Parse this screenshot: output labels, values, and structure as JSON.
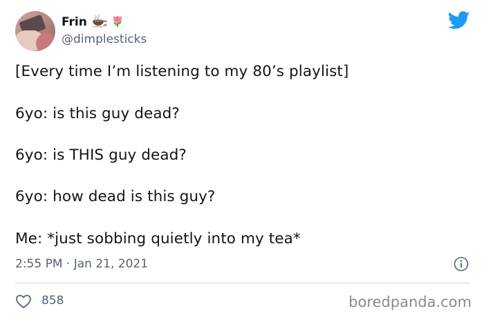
{
  "author": {
    "display_name": "Frin",
    "emojis": [
      "teacup-emoji",
      "tulip-emoji"
    ],
    "handle": "@dimplesticks"
  },
  "tweet": {
    "lines": [
      "[Every time I’m listening to my 80’s playlist]",
      "6yo: is this guy dead?",
      "6yo: is THIS guy dead?",
      "6yo: how dead is this guy?",
      "Me: *just sobbing quietly into my tea*"
    ],
    "timestamp": "2:55 PM · Jan 21, 2021"
  },
  "stats": {
    "likes": "858"
  },
  "watermark": "boredpanda.com",
  "icons": {
    "brand": "twitter-bird-icon",
    "info": "info-icon",
    "like": "heart-icon"
  },
  "colors": {
    "twitter_blue": "#1d9bf0",
    "secondary_text": "#536471",
    "primary_text": "#0f1419"
  }
}
